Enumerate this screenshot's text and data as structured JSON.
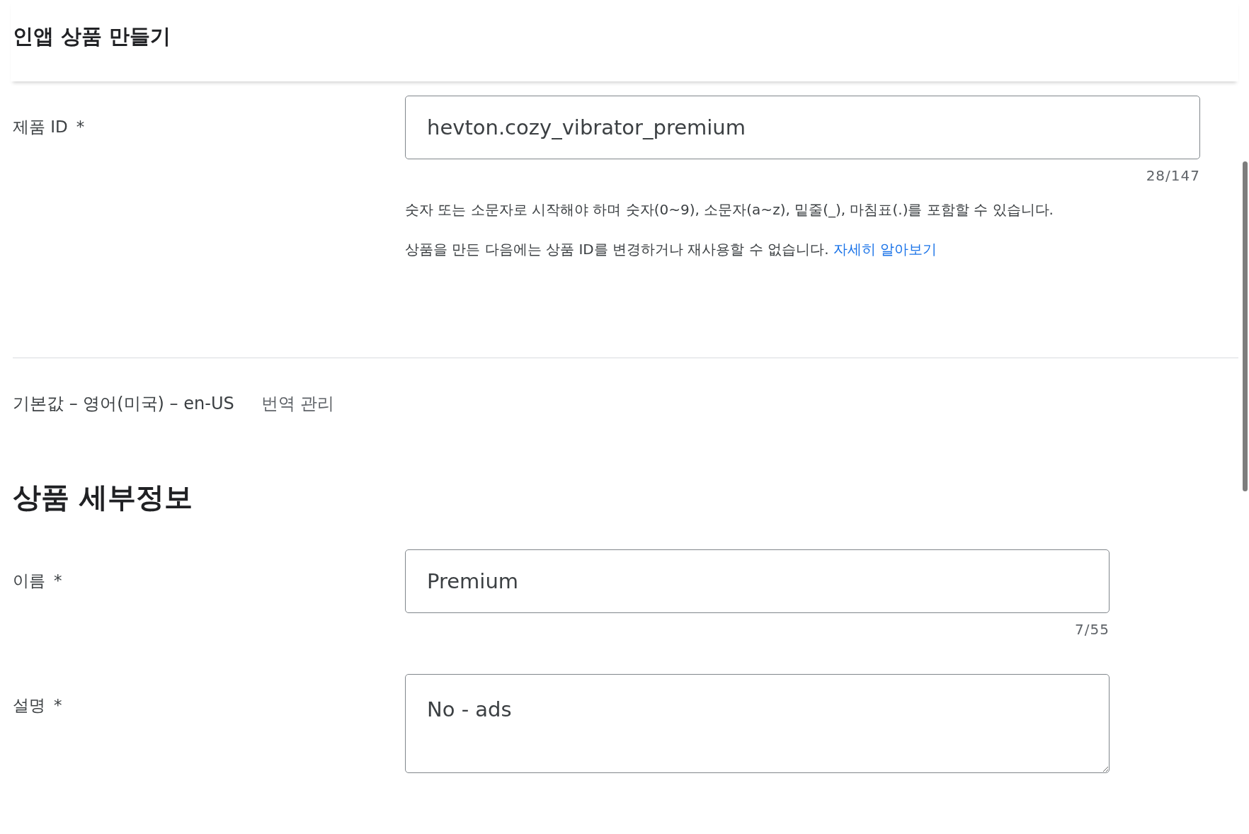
{
  "title": "인앱 상품 만들기",
  "product_id": {
    "label": "제품 ID",
    "mark": "*",
    "value": "hevton.cozy_vibrator_premium",
    "counter": "28/147",
    "help": "숫자 또는 소문자로 시작해야 하며 숫자(0~9), 소문자(a~z), 밑줄(_), 마침표(.)를 포함할 수 있습니다.",
    "note": "상품을 만든 다음에는 상품 ID를 변경하거나 재사용할 수 없습니다.",
    "note_link": "자세히 알아보기"
  },
  "language": {
    "default": "기본값 – 영어(미국) – en-US",
    "manage_link": "번역 관리"
  },
  "section_title": "상품 세부정보",
  "fields": [
    {
      "kind": "input",
      "label": "이름",
      "mark": "*",
      "value": "Premium",
      "counter": "7/55"
    },
    {
      "kind": "textarea",
      "label": "설명",
      "mark": "*",
      "value": "No - ads"
    }
  ]
}
